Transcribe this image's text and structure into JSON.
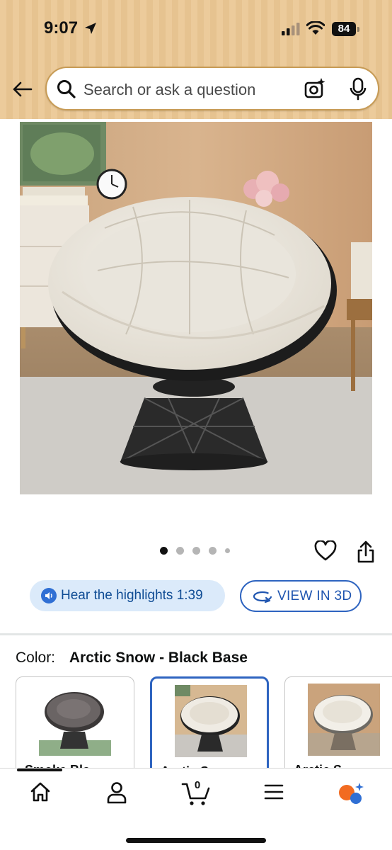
{
  "status_bar": {
    "time": "9:07",
    "battery": "84"
  },
  "search": {
    "placeholder": "Search or ask a question"
  },
  "product": {
    "image_alt": "White papasan swivel chair with black wicker base",
    "carousel": {
      "total": 5,
      "active_index": 1
    }
  },
  "actions": {
    "hear_highlights": "Hear the highlights 1:39",
    "view_3d": "VIEW IN 3D"
  },
  "color": {
    "label": "Color:",
    "selected": "Arctic Snow - Black Base",
    "options": [
      {
        "name": "Smoke Bla",
        "selected": false
      },
      {
        "name": "Arctic Sn",
        "selected": true
      },
      {
        "name": "Arctic S",
        "selected": false
      }
    ]
  },
  "nav": {
    "cart_count": "0"
  },
  "colors": {
    "header_bg": "#eccb9b",
    "accent_blue": "#2e64c0",
    "pill_bg": "#dbeafa"
  }
}
